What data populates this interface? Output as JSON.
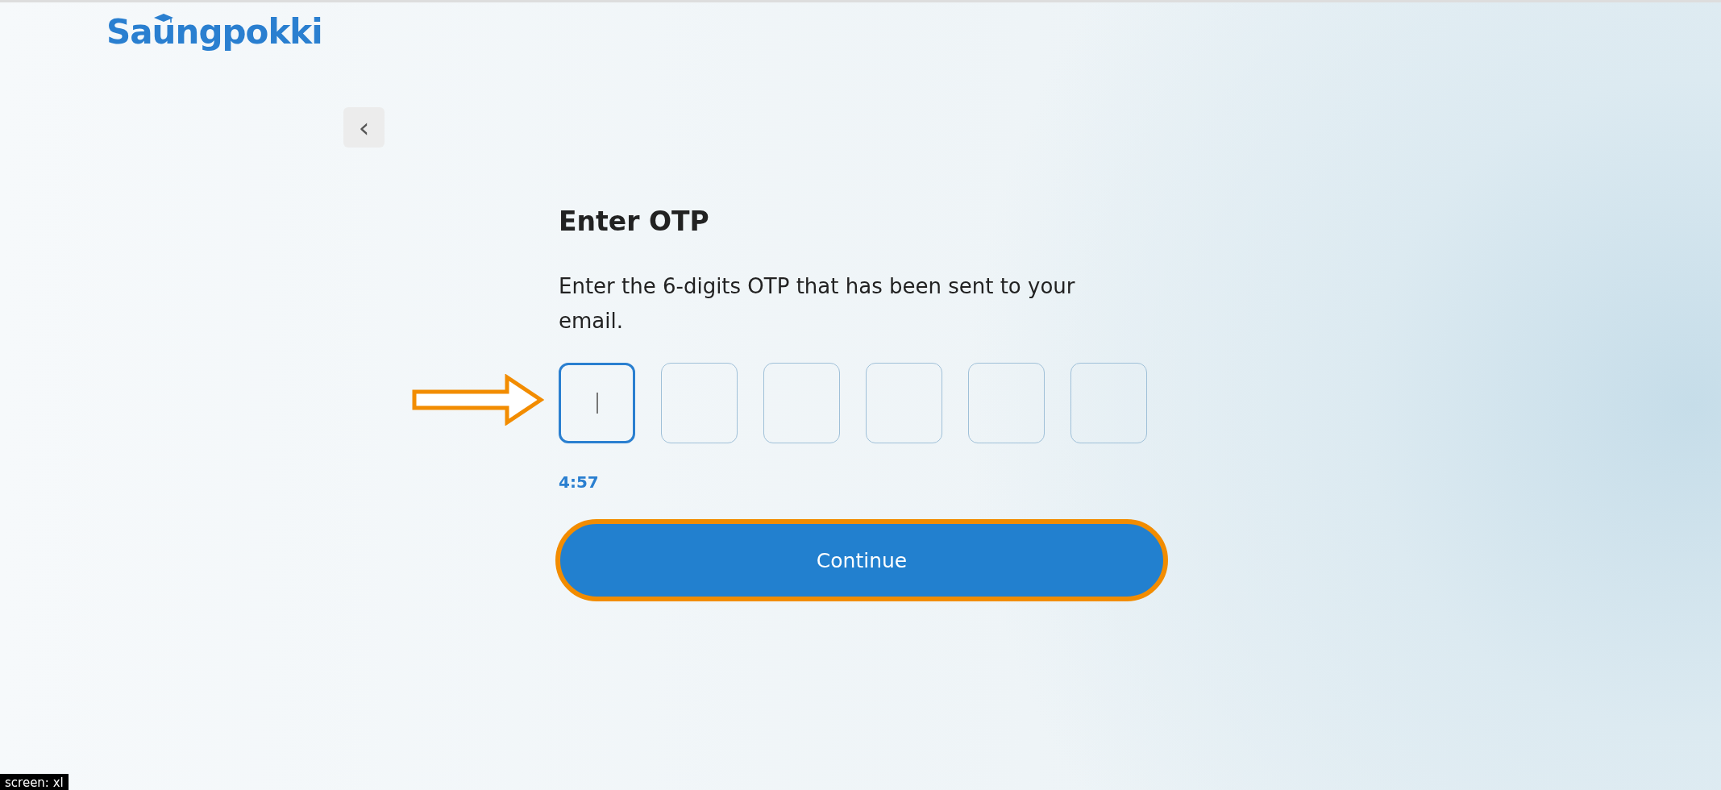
{
  "logo": {
    "parts": [
      "Sa",
      "u",
      "ngpokki"
    ]
  },
  "back_button": {
    "label": "‹"
  },
  "title": "Enter OTP",
  "instructions": "Enter the 6-digits OTP that has been sent to your email.",
  "otp_fields": [
    {
      "focused": true
    },
    {
      "focused": false
    },
    {
      "focused": false
    },
    {
      "focused": false
    },
    {
      "focused": false
    },
    {
      "focused": false
    }
  ],
  "timer": "4:57",
  "continue_button": {
    "label": "Continue",
    "highlighted": true
  },
  "screen_badge": "screen: xl"
}
